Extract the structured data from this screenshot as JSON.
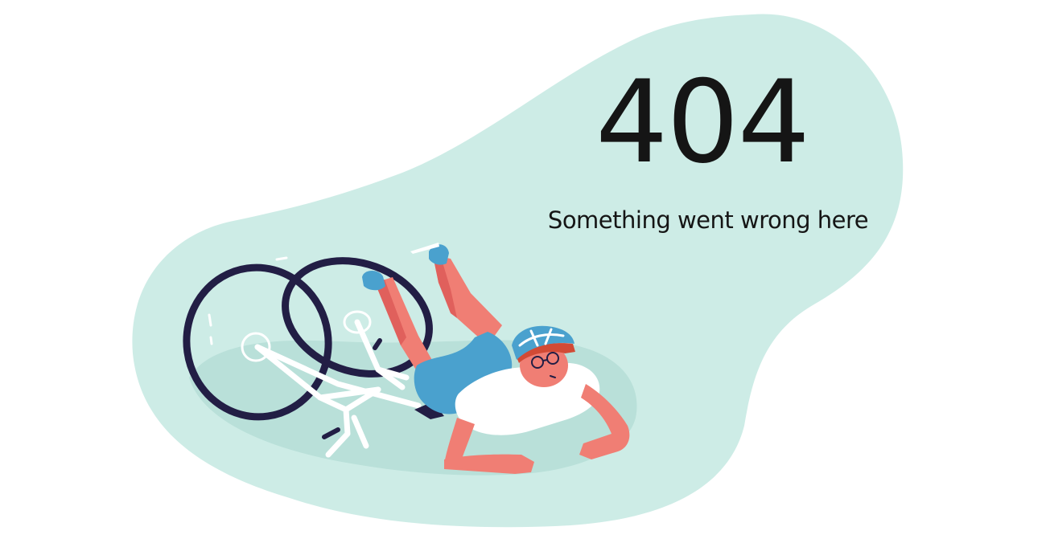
{
  "error": {
    "code": "404",
    "message": "Something went wrong here"
  },
  "illustration": {
    "subject": "cyclist-fallen-off-bicycle",
    "colors": {
      "blob": "#cdece6",
      "shadow": "#b9e0d9",
      "wheel": "#221e45",
      "frame": "#ffffff",
      "skin": "#f07e74",
      "skin_shade": "#e0605c",
      "shorts": "#4aa1ce",
      "shirt": "#ffffff",
      "helmet": "#4aa1ce",
      "hair": "#d24a35"
    }
  },
  "colors": {
    "text": "#151515",
    "background": "#ffffff"
  }
}
